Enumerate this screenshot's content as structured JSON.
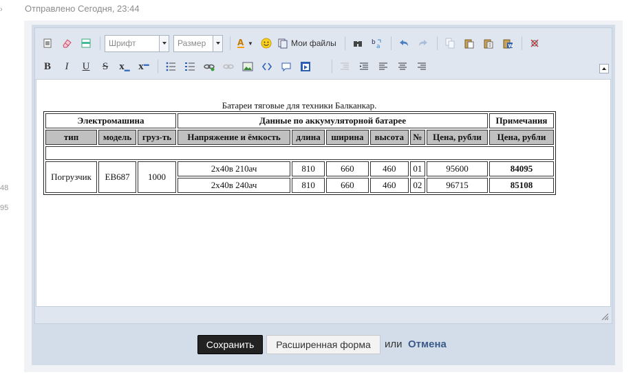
{
  "post": {
    "meta": "Отправлено Сегодня, 23:44",
    "left_edge_fragments": [
      "›",
      "48",
      "95"
    ]
  },
  "toolbar": {
    "font_combo": "Шрифт",
    "size_combo": "Размер",
    "my_files_label": "Мои файлы",
    "row1_icons": [
      "source-icon",
      "eraser-icon",
      "template-icon",
      "font-color-icon",
      "smiley-icon",
      "my-files-icon",
      "find-icon",
      "replace-icon",
      "undo-icon",
      "redo-icon",
      "copy-icon",
      "paste-icon",
      "paste-text-icon",
      "paste-word-icon",
      "spellcheck-icon"
    ],
    "row2_labels": {
      "bold": "B",
      "italic": "I",
      "underline": "U",
      "strike": "S",
      "subscript": "x",
      "superscript": "x"
    }
  },
  "content": {
    "title": "Батареи тяговые для техники Балканкар.",
    "table": {
      "group_headers": [
        "Электромашина",
        "Данные по аккумуляторной батарее",
        "Примечания"
      ],
      "columns": [
        "тип",
        "модель",
        "груз-ть",
        "Напряжение и ёмкость",
        "длина",
        "ширина",
        "высота",
        "№",
        "Цена, рубли",
        "Цена, рубли"
      ],
      "machine": {
        "type": "Погрузчик",
        "model": "ЕВ687",
        "capacity": "1000"
      },
      "rows": [
        {
          "voltage": "2х40в 210ач",
          "length": "810",
          "width": "660",
          "height": "460",
          "num": "01",
          "price": "95600",
          "note_price": "84095"
        },
        {
          "voltage": "2х40в 240ач",
          "length": "810",
          "width": "660",
          "height": "460",
          "num": "02",
          "price": "96715",
          "note_price": "85108"
        }
      ]
    }
  },
  "actions": {
    "save": "Сохранить",
    "advanced": "Расширенная форма",
    "or": "или",
    "cancel": "Отмена"
  }
}
